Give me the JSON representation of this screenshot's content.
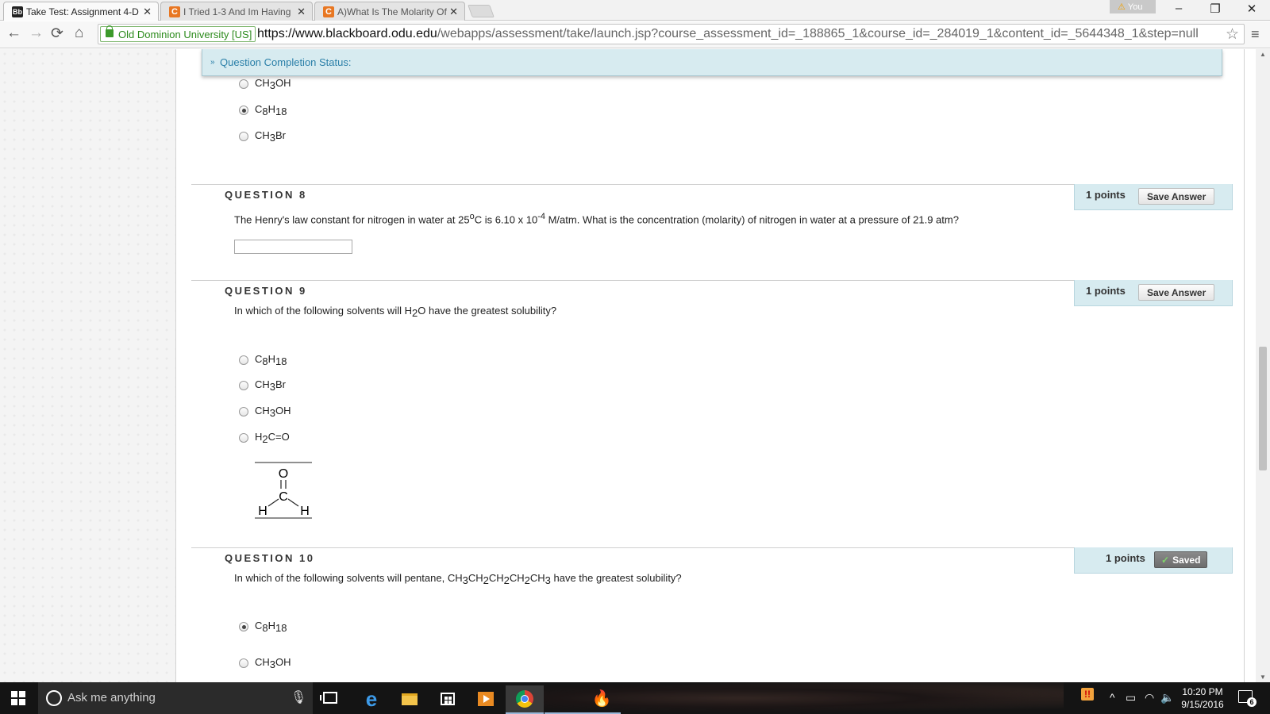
{
  "browser": {
    "tabs": [
      {
        "title": "Take Test: Assignment 4-D",
        "favicon": "Bb"
      },
      {
        "title": "I Tried 1-3 And Im Having",
        "favicon": "C"
      },
      {
        "title": "A)What Is The Molarity Of",
        "favicon": "C"
      }
    ],
    "user_label": "You",
    "window_controls": {
      "minimize": "–",
      "restore": "❐",
      "close": "✕"
    },
    "nav": {
      "back": "←",
      "forward": "→",
      "reload": "⟳",
      "home": "⌂"
    },
    "ev_label": "Old Dominion University [US]",
    "url_host": "https://www.blackboard.odu.edu",
    "url_path": "/webapps/assessment/take/launch.jsp?course_assessment_id=_188865_1&course_id=_284019_1&content_id=_5644348_1&step=null",
    "bookmark_icon": "☆",
    "menu_icon": "≡"
  },
  "status": {
    "label": "Question Completion Status:",
    "chevron": "»"
  },
  "q7": {
    "options": [
      {
        "parts": [
          "CH",
          "3",
          "OH"
        ],
        "selected": false
      },
      {
        "parts": [
          "C",
          "8",
          "H",
          "18"
        ],
        "selected": true
      },
      {
        "parts": [
          "CH",
          "3",
          "Br"
        ],
        "selected": false
      }
    ]
  },
  "q8": {
    "heading": "QUESTION 8",
    "points": "1 points",
    "save_label": "Save Answer",
    "text_a": "The Henry's law constant for nitrogen in water at 25",
    "text_sup1": "o",
    "text_b": "C is 6.10 x 10",
    "text_sup2": "-4",
    "text_c": " M/atm.  What is the concentration (molarity) of nitrogen in water at a pressure of 21.9 atm?",
    "answer_value": ""
  },
  "q9": {
    "heading": "QUESTION 9",
    "points": "1 points",
    "save_label": "Save Answer",
    "text_a": "In which of the following solvents will H",
    "text_sub": "2",
    "text_b": "O have the greatest solubility?",
    "options": [
      {
        "parts": [
          "C",
          "8",
          "H",
          "18"
        ],
        "selected": false
      },
      {
        "parts": [
          "CH",
          "3",
          "Br"
        ],
        "selected": false
      },
      {
        "parts": [
          "CH",
          "3",
          "OH"
        ],
        "selected": false
      },
      {
        "parts": [
          "H",
          "2",
          "C=O"
        ],
        "selected": false
      }
    ],
    "structure_labels": {
      "o": "O",
      "c": "C",
      "h_left": "H",
      "h_right": "H"
    }
  },
  "q10": {
    "heading": "QUESTION 10",
    "points": "1 points",
    "saved_label": "Saved",
    "saved_check": "✓",
    "text_parts": [
      "In which of the following solvents will pentane, CH",
      "3",
      "CH",
      "2",
      "CH",
      "2",
      "CH",
      "2",
      "CH",
      "3",
      " have the greatest solubility?"
    ],
    "options": [
      {
        "parts": [
          "C",
          "8",
          "H",
          "18"
        ],
        "selected": true
      },
      {
        "parts": [
          "CH",
          "3",
          "OH"
        ],
        "selected": false
      }
    ]
  },
  "taskbar": {
    "search_placeholder": "Ask me anything",
    "time": "10:20 PM",
    "date": "9/15/2016",
    "notification_count": "6",
    "icons": [
      "windows-start-icon",
      "cortana-icon",
      "task-view-icon",
      "edge-icon",
      "file-explorer-icon",
      "store-icon",
      "media-player-icon",
      "chrome-icon",
      "app-icon",
      "fire-app-icon"
    ]
  },
  "colors": {
    "accent_blue": "#2a7fa8",
    "question_box_bg": "#d7ebf0",
    "secure_green": "#2b8a1b"
  }
}
